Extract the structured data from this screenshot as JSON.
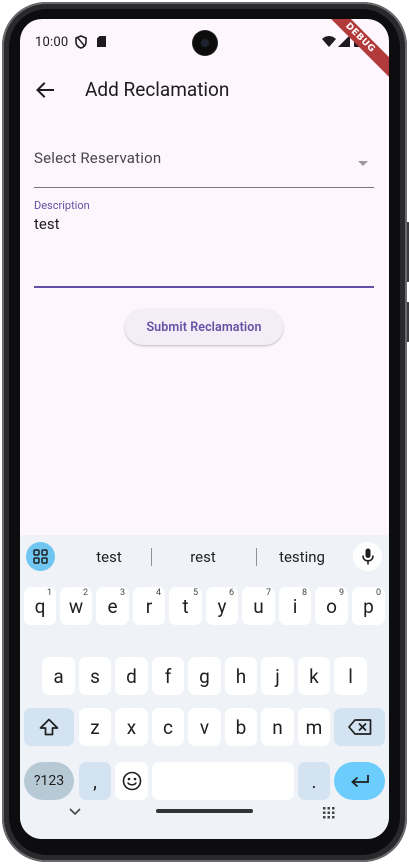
{
  "status_bar": {
    "time": "10:00",
    "debug_label": "DEBUG"
  },
  "app_bar": {
    "title": "Add Reclamation"
  },
  "form": {
    "reservation_select": {
      "placeholder": "Select Reservation"
    },
    "description": {
      "label": "Description",
      "value": "test"
    },
    "submit_label": "Submit Reclamation"
  },
  "keyboard": {
    "suggestions": [
      "test",
      "rest",
      "testing"
    ],
    "row1": [
      {
        "key": "q",
        "hint": "1"
      },
      {
        "key": "w",
        "hint": "2"
      },
      {
        "key": "e",
        "hint": "3"
      },
      {
        "key": "r",
        "hint": "4"
      },
      {
        "key": "t",
        "hint": "5"
      },
      {
        "key": "y",
        "hint": "6"
      },
      {
        "key": "u",
        "hint": "7"
      },
      {
        "key": "i",
        "hint": "8"
      },
      {
        "key": "o",
        "hint": "9"
      },
      {
        "key": "p",
        "hint": "0"
      }
    ],
    "row2": [
      "a",
      "s",
      "d",
      "f",
      "g",
      "h",
      "j",
      "k",
      "l"
    ],
    "row3": [
      "z",
      "x",
      "c",
      "v",
      "b",
      "n",
      "m"
    ],
    "numbers_label": "?123",
    "comma": ",",
    "period": "."
  },
  "colors": {
    "accent": "#6750a4",
    "background": "#fdf7fd",
    "keyboard_bg": "#eff3f8",
    "enter_key": "#6ccdfc"
  }
}
